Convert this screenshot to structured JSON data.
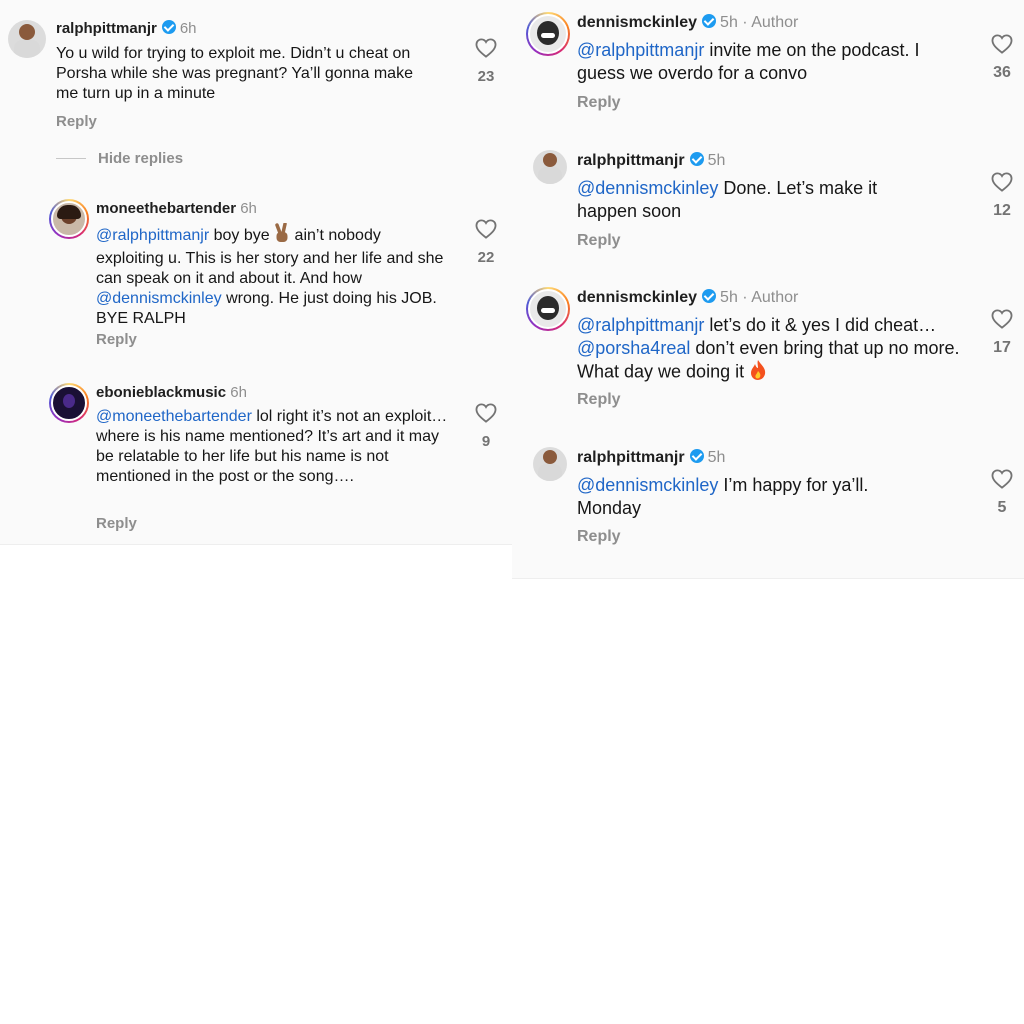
{
  "left": {
    "top_comment": {
      "username": "ralphpittmanjr",
      "time": "6h",
      "text": "Yo u wild for trying to exploit me. Didn’t u cheat on Porsha while she was pregnant? Ya’ll gonna make me turn up in a minute",
      "reply": "Reply",
      "likes": "23"
    },
    "hide_replies": "Hide replies",
    "replies": [
      {
        "username": "moneethebartender",
        "time": "6h",
        "mention1": "@ralphpittmanjr",
        "text1": " boy bye ",
        "text2": " ain’t nobody exploiting u. This is her story and her life and she can speak on it and about it. And how ",
        "mention2": "@dennismckinley",
        "text3": " wrong. He just doing his JOB. BYE RALPH",
        "reply": "Reply",
        "likes": "22"
      },
      {
        "username": "ebonieblackmusic",
        "time": "6h",
        "mention": "@moneethebartender",
        "text": " lol right it’s not an exploit… where is his name mentioned? It’s art and it may be relatable to her life but his name is not mentioned in the post or the song….",
        "reply": "Reply",
        "likes": "9"
      }
    ]
  },
  "right": {
    "comments": [
      {
        "username": "dennismckinley",
        "time": "5h",
        "author": "Author",
        "mention": "@ralphpittmanjr",
        "text": " invite me on the podcast. I guess we overdo for a convo",
        "reply": "Reply",
        "likes": "36"
      },
      {
        "username": "ralphpittmanjr",
        "time": "5h",
        "mention": "@dennismckinley",
        "text": " Done. Let’s make it happen soon",
        "reply": "Reply",
        "likes": "12"
      },
      {
        "username": "dennismckinley",
        "time": "5h",
        "author": "Author",
        "mention1": "@ralphpittmanjr",
        "text1": " let’s do it & yes I did cheat… ",
        "mention2": "@porsha4real",
        "text2": " don’t even bring that up no more. What day we doing it ",
        "reply": "Reply",
        "likes": "17"
      },
      {
        "username": "ralphpittmanjr",
        "time": "5h",
        "mention": "@dennismckinley",
        "text": " I’m happy for ya’ll. Monday",
        "reply": "Reply",
        "likes": "5"
      }
    ]
  },
  "colors": {
    "mention": "#1f66c7",
    "muted": "#8e8e8e",
    "verified": "#1d9bf0",
    "panel_bg": "#fafafa"
  },
  "icons": [
    "heart-icon",
    "verified-badge-icon",
    "victory-hand-emoji",
    "fire-emoji"
  ]
}
